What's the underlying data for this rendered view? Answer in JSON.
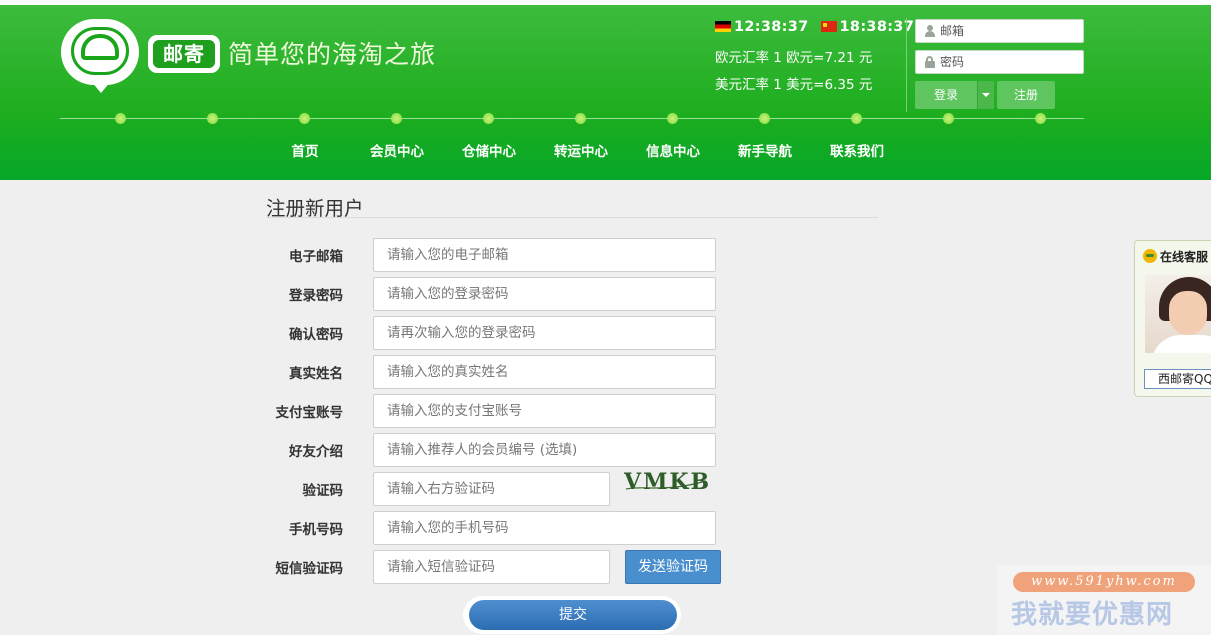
{
  "header": {
    "logo_text": "邮寄",
    "slogan": "简单您的海淘之旅",
    "clock_de": "12:38:37",
    "clock_cn": "18:38:37",
    "rate_eur": "欧元汇率  1 欧元=7.21 元",
    "rate_usd": "美元汇率  1 美元=6.35 元",
    "login": {
      "email_placeholder": "邮箱",
      "password_placeholder": "密码",
      "login_label": "登录",
      "register_label": "注册"
    }
  },
  "nav": [
    "首页",
    "会员中心",
    "仓储中心",
    "转运中心",
    "信息中心",
    "新手导航",
    "联系我们"
  ],
  "form": {
    "title": "注册新用户",
    "fields": [
      {
        "label": "电子邮箱",
        "placeholder": "请输入您的电子邮箱"
      },
      {
        "label": "登录密码",
        "placeholder": "请输入您的登录密码"
      },
      {
        "label": "确认密码",
        "placeholder": "请再次输入您的登录密码"
      },
      {
        "label": "真实姓名",
        "placeholder": "请输入您的真实姓名"
      },
      {
        "label": "支付宝账号",
        "placeholder": "请输入您的支付宝账号"
      },
      {
        "label": "好友介绍",
        "placeholder": "请输入推荐人的会员编号 (选填)"
      },
      {
        "label": "验证码",
        "placeholder": "请输入右方验证码"
      },
      {
        "label": "手机号码",
        "placeholder": "请输入您的手机号码"
      },
      {
        "label": "短信验证码",
        "placeholder": "请输入短信验证码"
      }
    ],
    "captcha_text": "VMKB",
    "send_code_label": "发送验证码",
    "submit_label": "提交"
  },
  "service_panel": {
    "title": "在线客服",
    "qq_button": "西邮寄QQ"
  },
  "watermark": {
    "url": "www.591yhw.com",
    "text": "我就要优惠网"
  },
  "colors": {
    "header_green": "#1fae1f",
    "button_blue": "#4a8fcd",
    "light_green": "#5fc55f"
  }
}
